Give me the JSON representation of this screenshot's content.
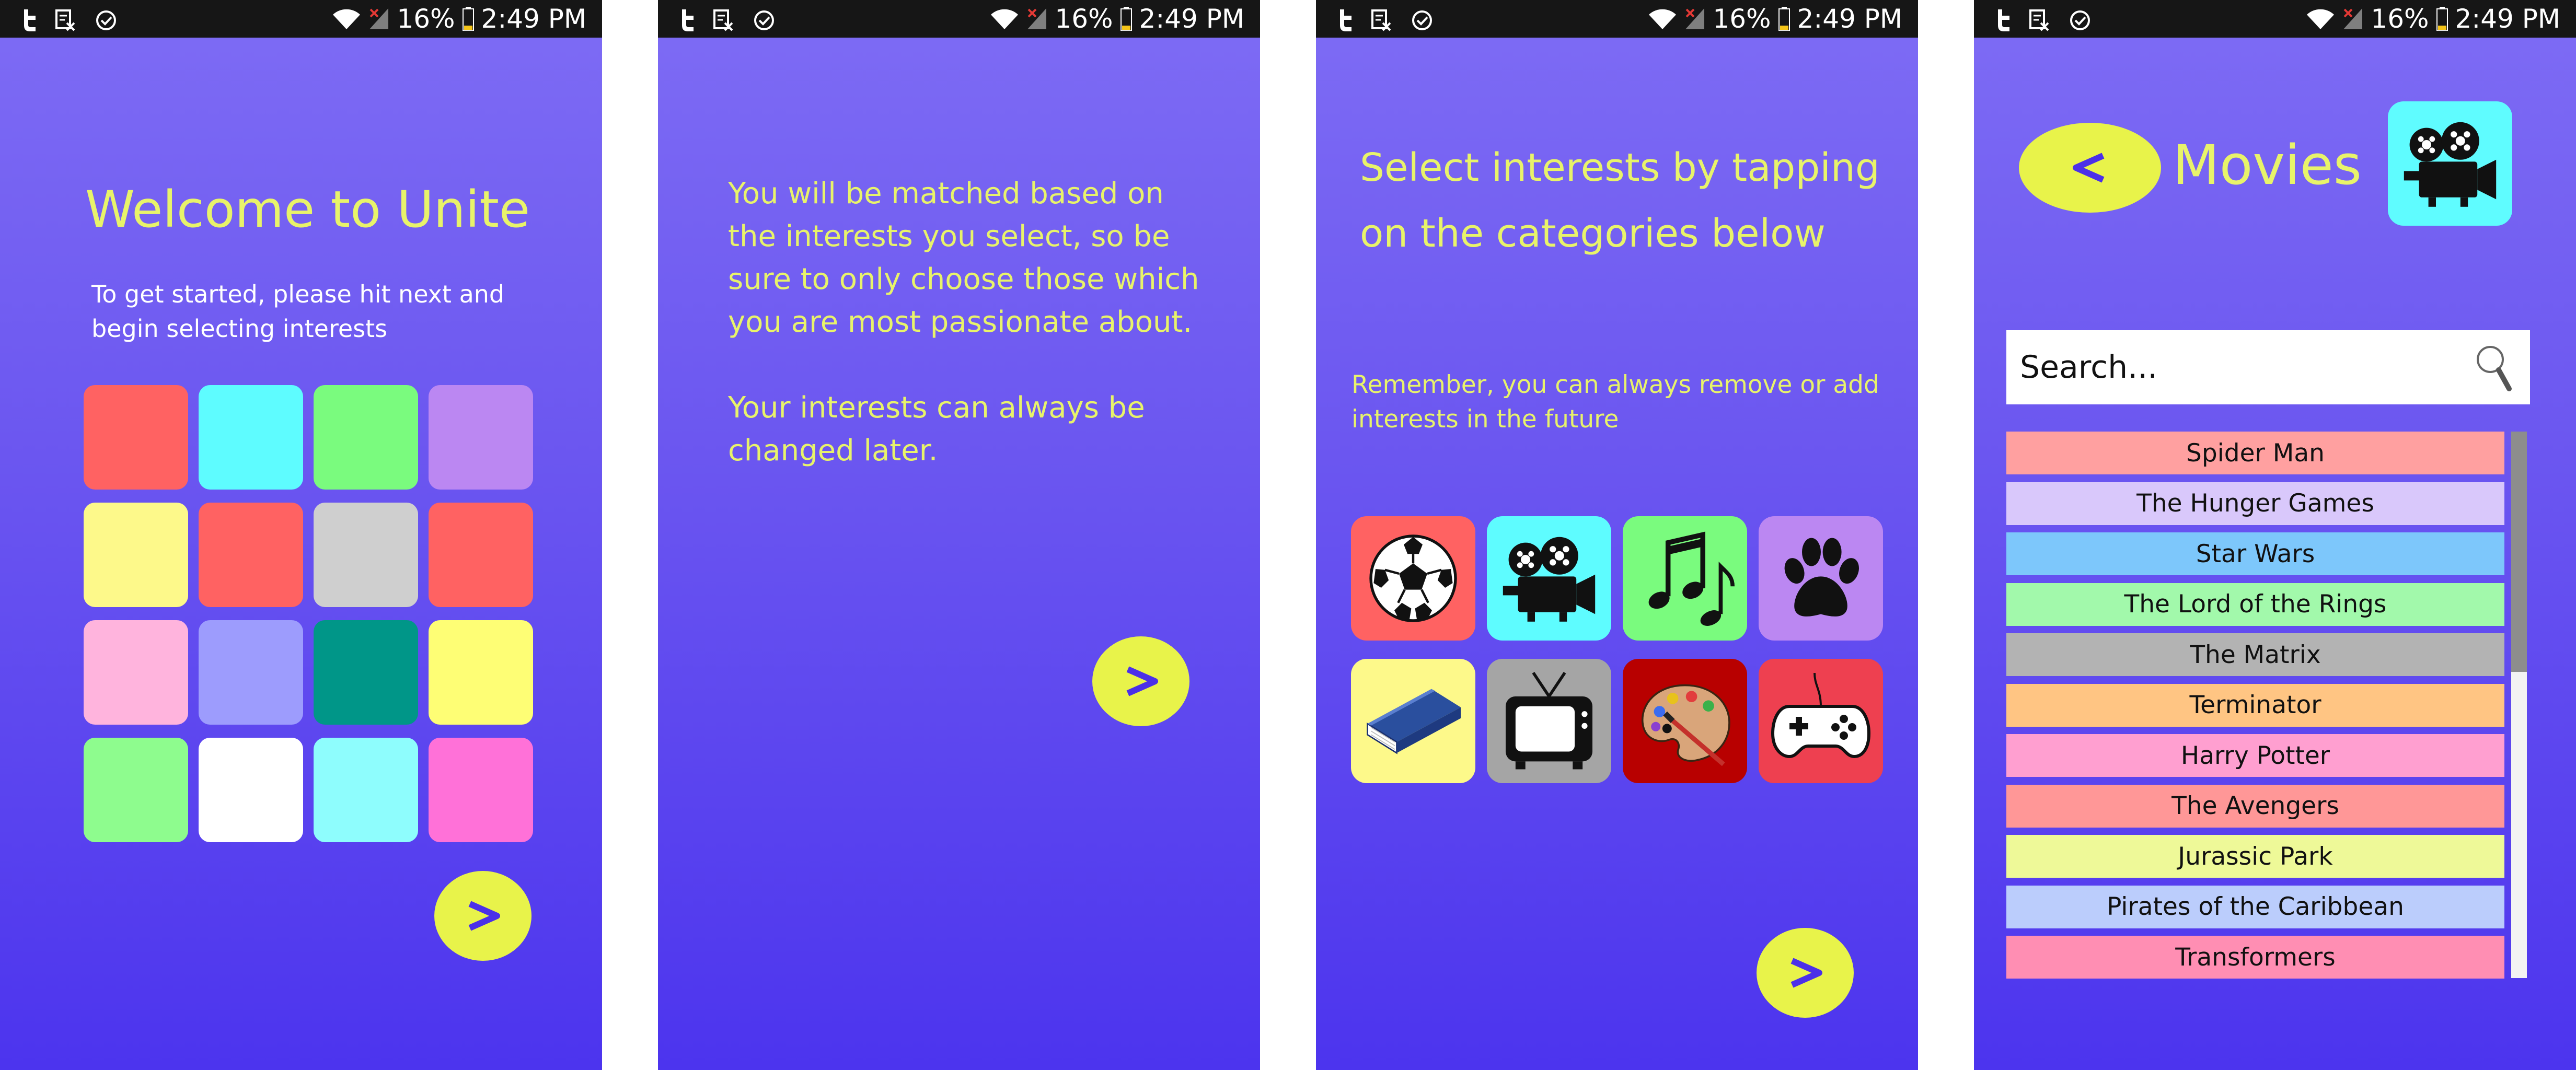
{
  "status_bar": {
    "battery": "16%",
    "time": "2:49 PM",
    "icons": [
      "t-notification-icon",
      "document-icon",
      "check-circle-icon",
      "wifi-icon",
      "signal-icon",
      "battery-icon"
    ]
  },
  "screen1": {
    "title": "Welcome to Unite",
    "subtitle": "To get started, please hit next and begin selecting interests",
    "swatches": [
      "#ff6262",
      "#5efcff",
      "#7afb7e",
      "#bb87f2",
      "#fdf98a",
      "#ff6262",
      "#cfcfcf",
      "#ff6262",
      "#ffb4dd",
      "#9d9cfd",
      "#009688",
      "#fefe75",
      "#8efc8e",
      "#ffffff",
      "#8efdfd",
      "#ff71d8"
    ],
    "next_label": ">"
  },
  "screen2": {
    "paragraph1": "You will be matched based on the interests you select, so be sure to only choose those which you are most passionate about.",
    "paragraph2": "Your interests can always be changed later.",
    "next_label": ">"
  },
  "screen3": {
    "title": "Select interests by tapping on the categories below",
    "subtitle": "Remember, you can always remove or add interests in the future",
    "categories": [
      {
        "icon": "soccer-ball-icon",
        "color": "#ff6262"
      },
      {
        "icon": "movie-camera-icon",
        "color": "#5efcff"
      },
      {
        "icon": "music-notes-icon",
        "color": "#7afb7e"
      },
      {
        "icon": "paw-icon",
        "color": "#bb87f2"
      },
      {
        "icon": "book-icon",
        "color": "#fdf98a"
      },
      {
        "icon": "tv-icon",
        "color": "#a5a5a5"
      },
      {
        "icon": "paint-palette-icon",
        "color": "#b80000"
      },
      {
        "icon": "game-controller-icon",
        "color": "#ee4050"
      }
    ],
    "next_label": ">"
  },
  "screen4": {
    "back_label": "<",
    "title": "Movies",
    "search_placeholder": "Search...",
    "movies": [
      {
        "label": "Spider Man",
        "color": "#ffa0a0"
      },
      {
        "label": "The Hunger Games",
        "color": "#d9c8fb"
      },
      {
        "label": "Star Wars",
        "color": "#7dc7fb"
      },
      {
        "label": "The Lord of the Rings",
        "color": "#a2f9ab"
      },
      {
        "label": "The Matrix",
        "color": "#b3b3b3"
      },
      {
        "label": "Terminator",
        "color": "#ffc583"
      },
      {
        "label": "Harry Potter",
        "color": "#ff9fd0"
      },
      {
        "label": "The Avengers",
        "color": "#ff9797"
      },
      {
        "label": "Jurassic Park",
        "color": "#eef998"
      },
      {
        "label": "Pirates of the Caribbean",
        "color": "#bbcdfc"
      },
      {
        "label": "Transformers",
        "color": "#ff8eb3"
      }
    ]
  },
  "colors": {
    "accent_yellow": "#e8f34a",
    "text_yellow": "#e8f36a",
    "gradient_top": "#7e6cf4",
    "gradient_bottom": "#4c34ee",
    "chevron": "#4b30e8"
  }
}
